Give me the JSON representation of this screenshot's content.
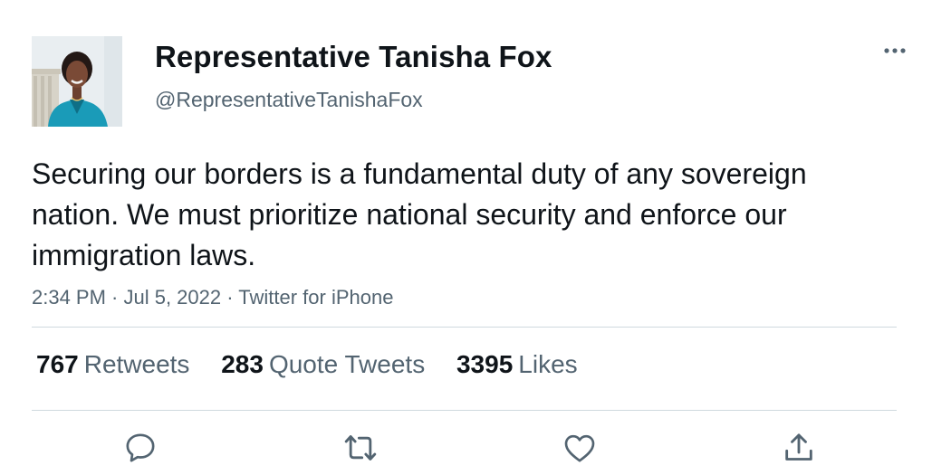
{
  "author": {
    "display_name": "Representative Tanisha Fox",
    "handle": "@RepresentativeTanishaFox",
    "avatar_icon": "profile-photo"
  },
  "tweet": {
    "text": "Securing our borders is a fundamental duty of any sovereign nation. We must prioritize national security and enforce our immigration laws.",
    "meta": "2:34 PM · Jul 5, 2022 · Twitter for iPhone"
  },
  "stats": {
    "retweets": {
      "count": "767",
      "label": "Retweets"
    },
    "quotes": {
      "count": "283",
      "label": "Quote Tweets"
    },
    "likes": {
      "count": "3395",
      "label": "Likes"
    }
  },
  "icons": {
    "more": "more-horizontal-icon",
    "reply": "reply-icon",
    "retweet": "retweet-icon",
    "like": "heart-icon",
    "share": "share-icon"
  },
  "colors": {
    "text_primary": "#0f1419",
    "text_secondary": "#536471",
    "divider": "#cfd9de",
    "icon": "#536471"
  }
}
